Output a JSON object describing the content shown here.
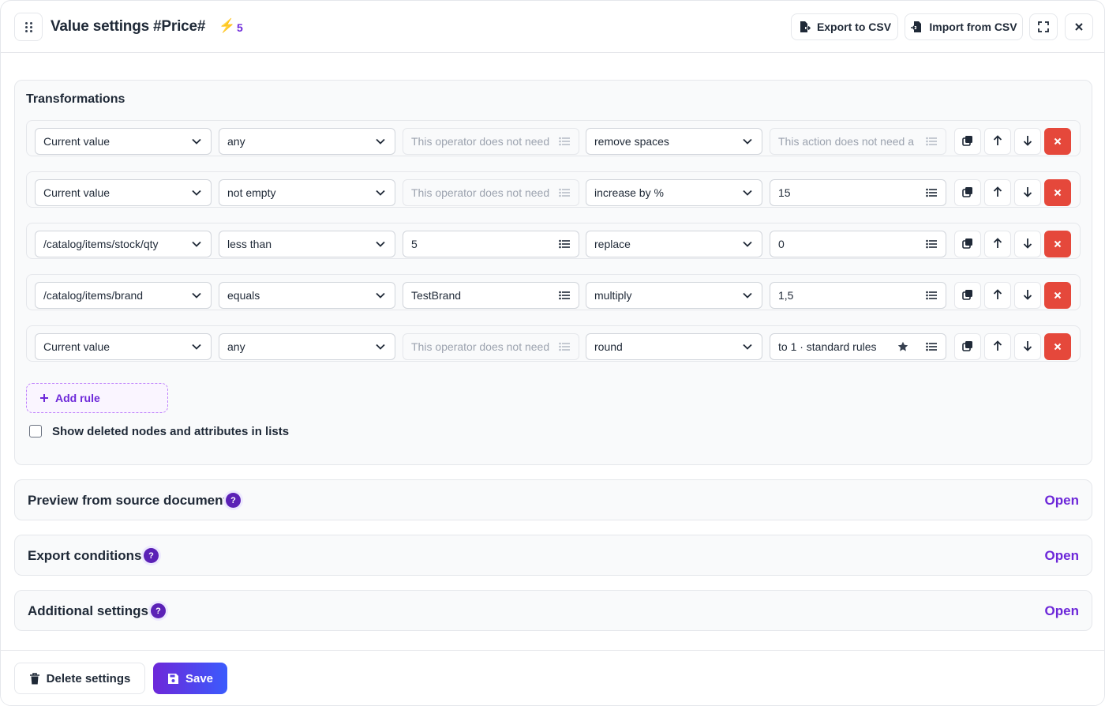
{
  "header": {
    "title": "Value settings #Price#",
    "bolt_icon": "lightning-icon",
    "bolt_count": "5",
    "export_label": "Export to CSV",
    "import_label": "Import from CSV"
  },
  "transformations": {
    "title": "Transformations",
    "rules": [
      {
        "source": "Current value",
        "operator": "any",
        "operand": "This operator does not need",
        "operand_disabled": true,
        "action": "remove spaces",
        "param": "This action does not need a",
        "param_disabled": true,
        "param_star": false
      },
      {
        "source": "Current value",
        "operator": "not empty",
        "operand": "This operator does not need",
        "operand_disabled": true,
        "action": "increase by %",
        "param": "15",
        "param_disabled": false,
        "param_star": false
      },
      {
        "source": "/catalog/items/stock/qty",
        "operator": "less than",
        "operand": "5",
        "operand_disabled": false,
        "action": "replace",
        "param": "0",
        "param_disabled": false,
        "param_star": false
      },
      {
        "source": "/catalog/items/brand",
        "operator": "equals",
        "operand": "TestBrand",
        "operand_disabled": false,
        "action": "multiply",
        "param": "1,5",
        "param_disabled": false,
        "param_star": false
      },
      {
        "source": "Current value",
        "operator": "any",
        "operand": "This operator does not need",
        "operand_disabled": true,
        "action": "round",
        "param": "to 1 · standard rules",
        "param_disabled": false,
        "param_star": true
      }
    ],
    "add_rule_label": "Add rule",
    "show_deleted_label": "Show deleted nodes and attributes in lists",
    "show_deleted_checked": false
  },
  "sections": [
    {
      "title": "Preview from source document",
      "open_label": "Open"
    },
    {
      "title": "Export conditions",
      "open_label": "Open"
    },
    {
      "title": "Additional settings",
      "open_label": "Open"
    }
  ],
  "footer": {
    "delete_label": "Delete settings",
    "save_label": "Save"
  },
  "colors": {
    "accent": "#6d28d9",
    "danger": "#e5483b",
    "bolt": "#f59e0b"
  }
}
